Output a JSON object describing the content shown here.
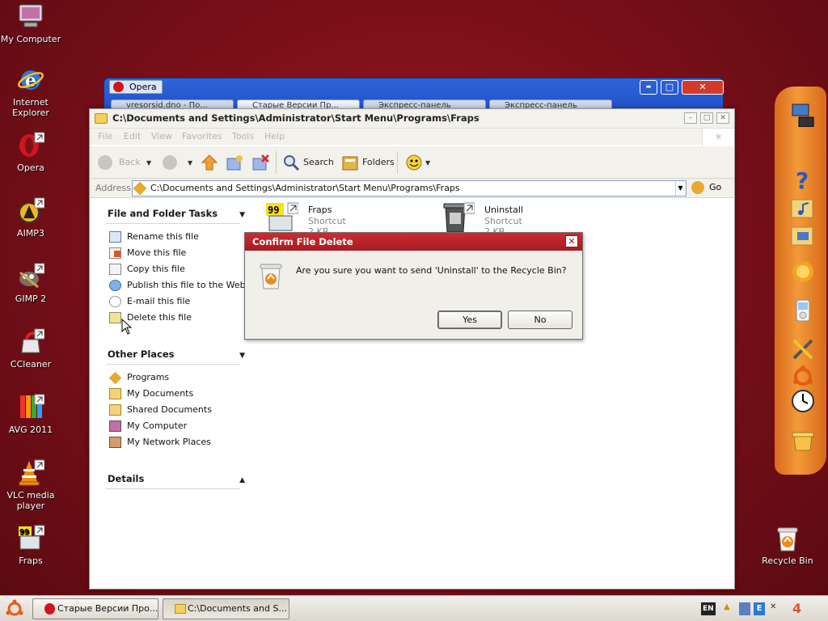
{
  "desktop_icons": [
    {
      "id": "my-computer",
      "label": "My Computer"
    },
    {
      "id": "internet-explorer",
      "label": "Internet Explorer"
    },
    {
      "id": "opera",
      "label": "Opera"
    },
    {
      "id": "aimp3",
      "label": "AIMP3"
    },
    {
      "id": "gimp",
      "label": "GIMP 2"
    },
    {
      "id": "ccleaner",
      "label": "CCleaner"
    },
    {
      "id": "avg",
      "label": "AVG 2011"
    },
    {
      "id": "vlc",
      "label": "VLC media player"
    },
    {
      "id": "fraps",
      "label": "Fraps"
    },
    {
      "id": "recycle-bin",
      "label": "Recycle Bin"
    }
  ],
  "opera_window": {
    "title": "Opera",
    "tabs": [
      "vresorsid.dno - Пo...",
      "Старые Версии Пр...",
      "Экспресс-панель",
      "Экспресс-панель"
    ],
    "minimize": "▬",
    "maximize": "□",
    "close": "✕"
  },
  "explorer": {
    "title": "C:\\Documents and Settings\\Administrator\\Start Menu\\Programs\\Fraps",
    "menu": [
      "File",
      "Edit",
      "View",
      "Favorites",
      "Tools",
      "Help"
    ],
    "toolbar": {
      "back": "Back",
      "search": "Search",
      "folders": "Folders"
    },
    "address": {
      "label": "Address",
      "value": "C:\\Documents and Settings\\Administrator\\Start Menu\\Programs\\Fraps",
      "go": "Go"
    },
    "file_tasks": {
      "header": "File and Folder Tasks",
      "items": [
        "Rename this file",
        "Move this file",
        "Copy this file",
        "Publish this file to the Web",
        "E-mail this file",
        "Delete this file"
      ]
    },
    "other_places": {
      "header": "Other Places",
      "items": [
        "Programs",
        "My Documents",
        "Shared Documents",
        "My Computer",
        "My Network Places"
      ]
    },
    "details": {
      "header": "Details"
    },
    "files": [
      {
        "name": "Fraps",
        "type": "Shortcut",
        "size": "2 KB"
      },
      {
        "name": "Uninstall",
        "type": "Shortcut",
        "size": "2 KB"
      }
    ]
  },
  "dialog": {
    "title": "Confirm File Delete",
    "message": "Are you sure you want to send 'Uninstall' to the Recycle Bin?",
    "yes": "Yes",
    "no": "No",
    "close": "✕"
  },
  "taskbar": {
    "buttons": [
      "Старые Версии Про...",
      "C:\\Documents and S..."
    ],
    "tray": {
      "lang": "EN",
      "clock": "4"
    }
  },
  "colors": {
    "desktop": "#7c1019",
    "dialog_title": "#b8232a",
    "dock": "#ef8a2c",
    "opera_title": "#2451c9"
  }
}
